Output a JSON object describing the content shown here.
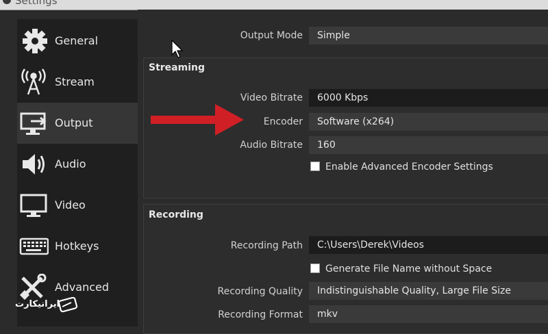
{
  "window": {
    "title": "Settings"
  },
  "sidebar": {
    "items": [
      {
        "label": "General",
        "icon": "gear-icon"
      },
      {
        "label": "Stream",
        "icon": "broadcast-antenna-icon"
      },
      {
        "label": "Output",
        "icon": "monitor-output-icon",
        "selected": true
      },
      {
        "label": "Audio",
        "icon": "speaker-icon"
      },
      {
        "label": "Video",
        "icon": "monitor-icon"
      },
      {
        "label": "Hotkeys",
        "icon": "keyboard-icon"
      },
      {
        "label": "Advanced",
        "icon": "tools-icon"
      }
    ]
  },
  "output": {
    "mode_label": "Output Mode",
    "mode_value": "Simple"
  },
  "streaming": {
    "title": "Streaming",
    "video_bitrate_label": "Video Bitrate",
    "video_bitrate_value": "6000 Kbps",
    "encoder_label": "Encoder",
    "encoder_value": "Software (x264)",
    "audio_bitrate_label": "Audio Bitrate",
    "audio_bitrate_value": "160",
    "advanced_checkbox_label": "Enable Advanced Encoder Settings",
    "advanced_checked": false
  },
  "recording": {
    "title": "Recording",
    "path_label": "Recording Path",
    "path_value": "C:\\Users\\Derek\\Videos",
    "filename_checkbox_label": "Generate File Name without Space",
    "filename_checked": false,
    "quality_label": "Recording Quality",
    "quality_value": "Indistinguishable Quality, Large File Size",
    "format_label": "Recording Format",
    "format_value": "mkv"
  },
  "annotation": {
    "arrow_color": "#d11f26"
  },
  "watermark": {
    "text": "ایرانیکارت"
  },
  "colors": {
    "background": "#2b2b2b",
    "sidebar": "#1f1f1f",
    "selected": "#363636",
    "field": "#3a3a3a"
  }
}
